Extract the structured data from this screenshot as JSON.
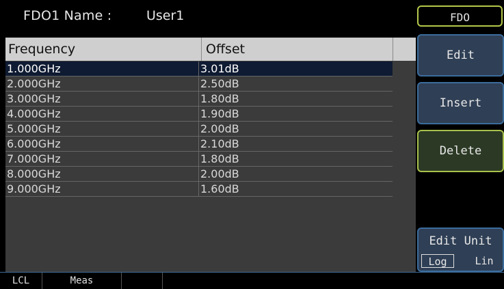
{
  "title": {
    "name_label": "FDO1 Name :",
    "name_value": "User1"
  },
  "table": {
    "headers": [
      "Frequency",
      "Offset"
    ],
    "rows": [
      {
        "frequency": "1.000GHz",
        "offset": "3.01dB"
      },
      {
        "frequency": "2.000GHz",
        "offset": "2.50dB"
      },
      {
        "frequency": "3.000GHz",
        "offset": "1.80dB"
      },
      {
        "frequency": "4.000GHz",
        "offset": "1.90dB"
      },
      {
        "frequency": "5.000GHz",
        "offset": "2.00dB"
      },
      {
        "frequency": "6.000GHz",
        "offset": "2.10dB"
      },
      {
        "frequency": "7.000GHz",
        "offset": "1.80dB"
      },
      {
        "frequency": "8.000GHz",
        "offset": "2.00dB"
      },
      {
        "frequency": "9.000GHz",
        "offset": "1.60dB"
      }
    ],
    "selected_index": 0
  },
  "softkeys": {
    "menu_title": "FDO",
    "edit": "Edit",
    "insert": "Insert",
    "delete": "Delete",
    "edit_unit": {
      "label": "Edit Unit",
      "options": [
        "Log",
        "Lin"
      ],
      "selected": "Log"
    }
  },
  "status": {
    "items": [
      "LCL",
      "Meas",
      "",
      ""
    ]
  },
  "colors": {
    "background": "#000000",
    "table_panel": "#3b3b3b",
    "header_bg": "#cfcfcf",
    "selected_row": "#0f1b32",
    "softkey_blue_fill": "#2f3f55",
    "softkey_blue_border": "#3b6c9c",
    "softkey_green_fill": "#2c3a25",
    "softkey_green_border": "#a9c24c"
  }
}
